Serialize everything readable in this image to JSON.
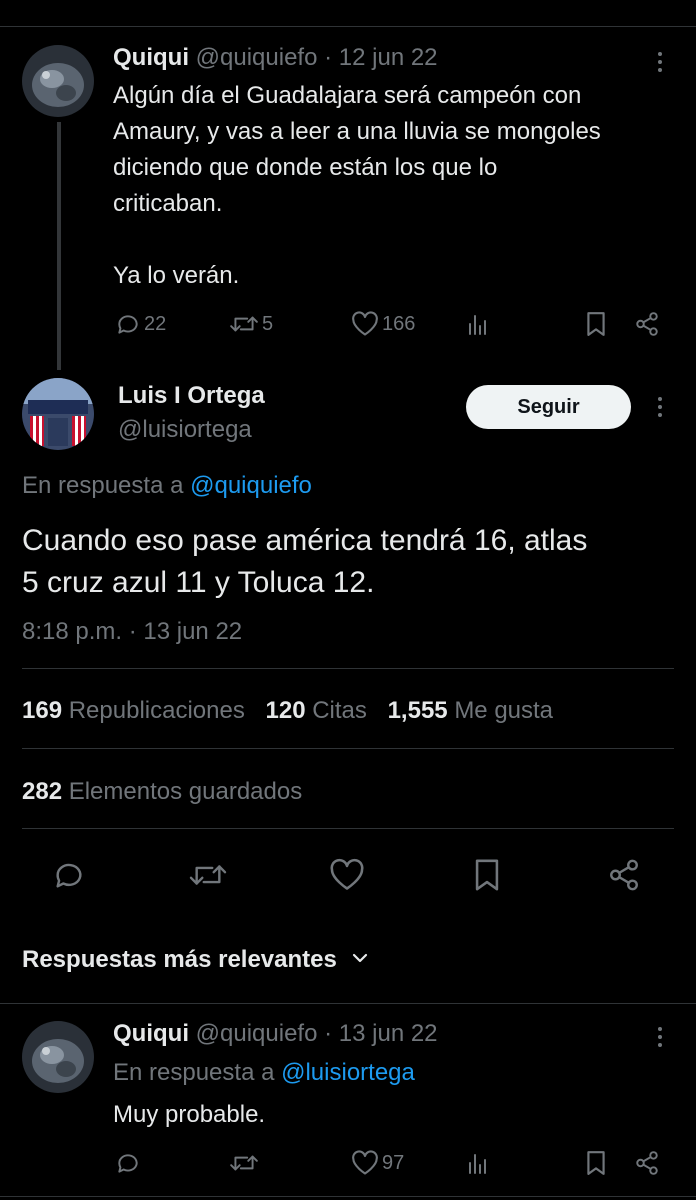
{
  "parent_tweet": {
    "name": "Quiqui",
    "handle": "@quiquiefo",
    "date": "· 12 jun 22",
    "lines": [
      "Algún día el Guadalajara será campeón con",
      "Amaury, y vas a leer a una lluvia se mongoles",
      "diciendo que donde están los que lo",
      "criticaban.",
      "",
      "Ya lo verán."
    ],
    "replies": "22",
    "retweets": "5",
    "likes": "166"
  },
  "main_tweet": {
    "name": "Luis I Ortega",
    "handle": "@luisiortega",
    "follow_label": "Seguir",
    "reply_prefix": "En respuesta a",
    "reply_to": "@quiquiefo",
    "lines": [
      "Cuando eso pase américa tendrá 16, atlas",
      "5 cruz azul 11 y Toluca 12."
    ],
    "timestamp": "8:18 p.m. · 13 jun 22",
    "stats": {
      "reposts_count": "169",
      "reposts_label": "Republicaciones",
      "quotes_count": "120",
      "quotes_label": "Citas",
      "likes_count": "1,555",
      "likes_label": "Me gusta",
      "bookmarks_count": "282",
      "bookmarks_label": "Elementos guardados"
    }
  },
  "replies_header": {
    "label": "Respuestas más relevantes"
  },
  "reply_tweet": {
    "name": "Quiqui",
    "handle": "@quiquiefo",
    "date": "· 13 jun 22",
    "reply_prefix": "En respuesta a",
    "reply_to": "@luisiortega",
    "text": "Muy probable.",
    "likes": "97"
  },
  "colors": {
    "background": "#000000",
    "text": "#e7e9ea",
    "muted": "#71767b",
    "link": "#1d9bf0",
    "divider": "#2f3336"
  },
  "icons": [
    "reply-icon",
    "retweet-icon",
    "like-icon",
    "views-icon",
    "bookmark-icon",
    "share-icon",
    "more-icon",
    "chevron-down-icon"
  ]
}
